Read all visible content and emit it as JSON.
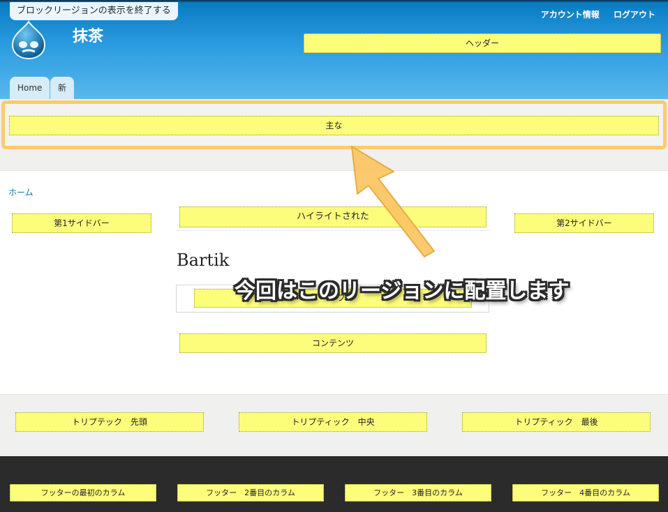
{
  "header": {
    "exit_link": "ブロックリージョンの表示を終了する",
    "site_name": "抹茶",
    "secondary_menu": [
      "アカウント情報",
      "ログアウト"
    ],
    "header_region": "ヘッダー"
  },
  "tabs": [
    "Home",
    "新着情報"
  ],
  "regions": {
    "featured": "主な",
    "breadcrumb": "ホーム",
    "sidebar_first": "第1サイドバー",
    "highlighted": "ハイライトされた",
    "sidebar_second": "第2サイドバー",
    "page_title": "Bartik",
    "help": "ヘルプ",
    "content": "コンテンツ",
    "triptych": [
      "トリプテック　先頭",
      "トリプティック　中央",
      "トリプティック　最後"
    ],
    "footer": [
      "フッターの最初のカラム",
      "フッター　2番目のカラム",
      "フッター　3番目のカラム",
      "フッター　4番目のカラム"
    ]
  },
  "annotation": {
    "callout": "今回はこのリージョンに配置します",
    "color": "#fccb6a"
  },
  "colors": {
    "region_fill": "#fdfd7c",
    "header_top": "#0779bf",
    "header_bottom": "#5ab8ec",
    "footer": "#2b2b2b"
  }
}
